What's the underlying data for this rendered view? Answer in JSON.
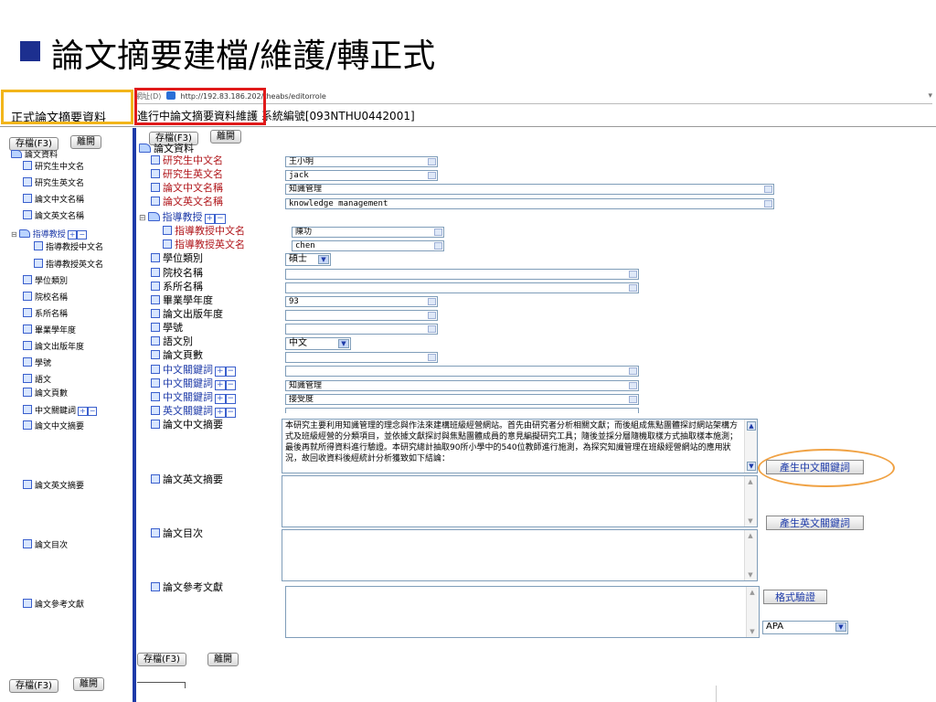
{
  "slide": {
    "title": "論文摘要建檔/維護/轉正式"
  },
  "address_bar": {
    "label": "網址(D)",
    "url": "http://192.83.186.202/theabs/editorrole"
  },
  "header": {
    "left_text": "正式論文摘要資料",
    "right_text": "進行中論文摘要資料維護 系統編號[093NTHU0442001]"
  },
  "sidebar": {
    "save_label": "存檔(F3)",
    "leave_label": "離開",
    "root_label": "論文資料",
    "items": [
      {
        "label": "研究生中文名"
      },
      {
        "label": "研究生英文名"
      },
      {
        "label": "論文中文名稱"
      },
      {
        "label": "論文英文名稱"
      },
      {
        "label": "指導教授"
      },
      {
        "label": "指導教授中文名"
      },
      {
        "label": "指導教授英文名"
      },
      {
        "label": "學位類別"
      },
      {
        "label": "院校名稱"
      },
      {
        "label": "系所名稱"
      },
      {
        "label": "畢業學年度"
      },
      {
        "label": "論文出版年度"
      },
      {
        "label": "學號"
      },
      {
        "label": "語文"
      },
      {
        "label": "論文頁數"
      },
      {
        "label": "中文關鍵詞"
      },
      {
        "label": "論文中文摘要"
      },
      {
        "label": "論文英文摘要"
      },
      {
        "label": "論文目次"
      },
      {
        "label": "論文參考文獻"
      }
    ]
  },
  "form": {
    "save_label": "存檔(F3)",
    "leave_label": "離開",
    "root_label": "論文資料",
    "labels": {
      "student_zh": "研究生中文名",
      "student_en": "研究生英文名",
      "title_zh": "論文中文名稱",
      "title_en": "論文英文名稱",
      "advisor": "指導教授",
      "advisor_zh": "指導教授中文名",
      "advisor_en": "指導教授英文名",
      "degree": "學位類別",
      "school": "院校名稱",
      "dept": "系所名稱",
      "grad_year": "畢業學年度",
      "pub_year": "論文出版年度",
      "student_id": "學號",
      "language": "語文別",
      "pages": "論文頁數",
      "kw1": "中文關鍵詞",
      "kw2": "中文關鍵詞",
      "kw3": "中文關鍵詞",
      "kw_en": "英文關鍵詞",
      "abstract_zh": "論文中文摘要",
      "abstract_en": "論文英文摘要",
      "toc": "論文目次",
      "refs": "論文參考文獻"
    },
    "values": {
      "student_zh": "王小明",
      "student_en": "jack",
      "title_zh": "知識管理",
      "title_en": "knowledge management",
      "advisor_zh": "陳功",
      "advisor_en": "chen",
      "degree": "碩士",
      "school": "",
      "dept": "",
      "grad_year": "93",
      "pub_year": "",
      "student_id": "",
      "language": "中文",
      "pages": "",
      "kw1": "",
      "kw2": "知識管理",
      "kw3": "接受度",
      "kw_en": "",
      "abstract_zh": "本研究主要利用知識管理的理念與作法來建構班級經營網站。首先由研究者分析相關文獻；而後組成焦點團體探討網站架構方式及班級經營的分類項目，並依據文獻探討與焦點團體成員的意見編擬研究工具；隨後並採分層隨機取樣方式抽取樣本施測；最後再就所得資料進行驗證。本研究總計抽取90所小學中的540位教師進行施測，為探究知識管理在班級經營網站的應用狀況，故回收資料後經統計分析獲致如下結論：",
      "abstract_en": "",
      "toc": "",
      "refs": ""
    },
    "gen_zh_keywords": "產生中文關鍵詞",
    "gen_en_keywords": "產生英文關鍵詞",
    "format_check": "格式驗證",
    "citation_style": "APA",
    "bottom_save_label": "存檔(F3)",
    "bottom_leave_label": "離開"
  }
}
